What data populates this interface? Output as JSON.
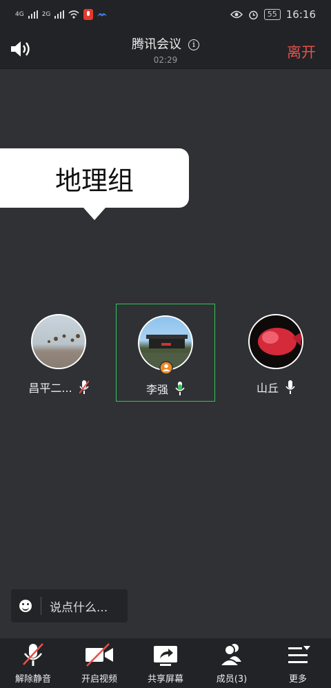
{
  "status_bar": {
    "net1": "4G",
    "net2": "2G",
    "battery": "55",
    "time": "16:16"
  },
  "header": {
    "title": "腾讯会议",
    "timer": "02:29",
    "leave_label": "离开",
    "info_glyph": "i"
  },
  "bubble": {
    "text": "地理组"
  },
  "participants": [
    {
      "name": "昌平二...",
      "mic": "muted",
      "avatar": "balloons-landscape"
    },
    {
      "name": "李强",
      "mic": "active",
      "avatar": "water-town-photo",
      "host": true,
      "selected": true
    },
    {
      "name": "山丘",
      "mic": "on",
      "avatar": "red-fish-photo"
    }
  ],
  "chat": {
    "placeholder": "说点什么..."
  },
  "toolbar": {
    "unmute": "解除静音",
    "video": "开启视频",
    "share": "共享屏幕",
    "members": "成员(3)",
    "more": "更多"
  },
  "colors": {
    "accent_green": "#33c35b",
    "leave_red": "#e8504a",
    "background": "#2f3135",
    "bar": "#222326"
  }
}
